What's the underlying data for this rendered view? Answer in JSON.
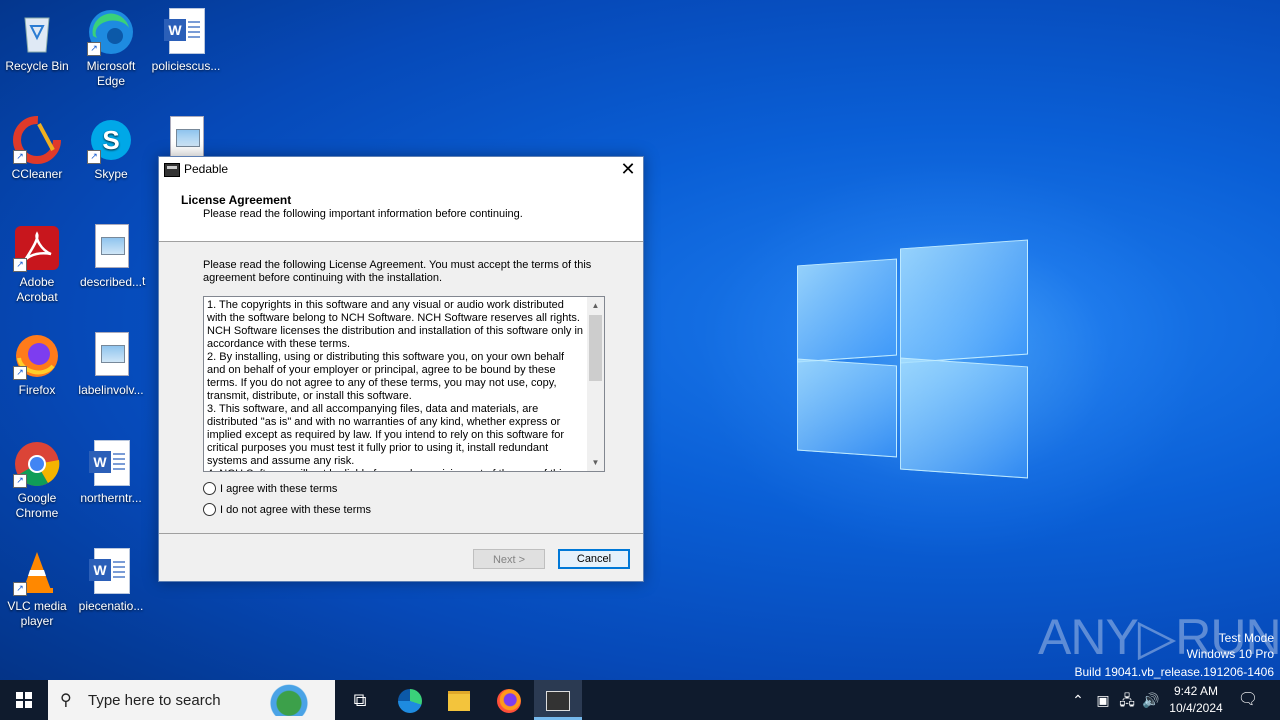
{
  "desktop": {
    "icons": [
      {
        "label": "Recycle Bin"
      },
      {
        "label": "Microsoft Edge"
      },
      {
        "label": "policiescus..."
      },
      {
        "label": "CCleaner"
      },
      {
        "label": "Skype"
      },
      {
        "label": "Adobe Acrobat"
      },
      {
        "label": "described..."
      },
      {
        "label": "Firefox"
      },
      {
        "label": "labelinvolv..."
      },
      {
        "label": "Google Chrome"
      },
      {
        "label": "northerntr..."
      },
      {
        "label": "VLC media player"
      },
      {
        "label": "piecenatio..."
      }
    ],
    "partial_label": "t"
  },
  "dialog": {
    "title": "Pedable",
    "close_glyph": "✕",
    "heading": "License Agreement",
    "subheading": "Please read the following important information before continuing.",
    "intro": "Please read the following License Agreement. You must accept the terms of this agreement before continuing with the installation.",
    "license_text": "1. The copyrights in this software and any visual or audio work distributed with the software belong to NCH Software. NCH Software reserves all rights. NCH Software licenses the distribution and installation of this software only in accordance with these terms.\n2. By installing, using or distributing this software you, on your own behalf and on behalf of your employer or principal, agree to be bound by these terms. If you do not agree to any of these terms, you may not use, copy, transmit, distribute, or install this software.\n3. This software, and all accompanying files, data and materials, are distributed \"as is\" and with no warranties of any kind, whether express or implied except as required by law. If you intend to rely on this software for critical purposes you must test it fully prior to using it, install redundant systems and assume any risk.\n4. NCH Software will not be liable for any loss arising out of the use of this",
    "radio_agree": "I agree with these terms",
    "radio_disagree": "I do not agree with these terms",
    "next_label": "Next >",
    "cancel_label": "Cancel"
  },
  "watermark": {
    "brand": "ANY▷RUN",
    "mode": "Test Mode",
    "edition": "Windows 10 Pro",
    "build": "Build 19041.vb_release.191206-1406"
  },
  "taskbar": {
    "search_placeholder": "Type here to search",
    "time": "9:42 AM",
    "date": "10/4/2024"
  },
  "icons": {
    "start": "windows-logo-icon",
    "search": "magnifier-icon",
    "task_view": "task-view-icon",
    "edge": "edge-icon",
    "explorer": "folder-icon",
    "firefox": "firefox-icon",
    "pedable": "pedable-app-icon"
  }
}
